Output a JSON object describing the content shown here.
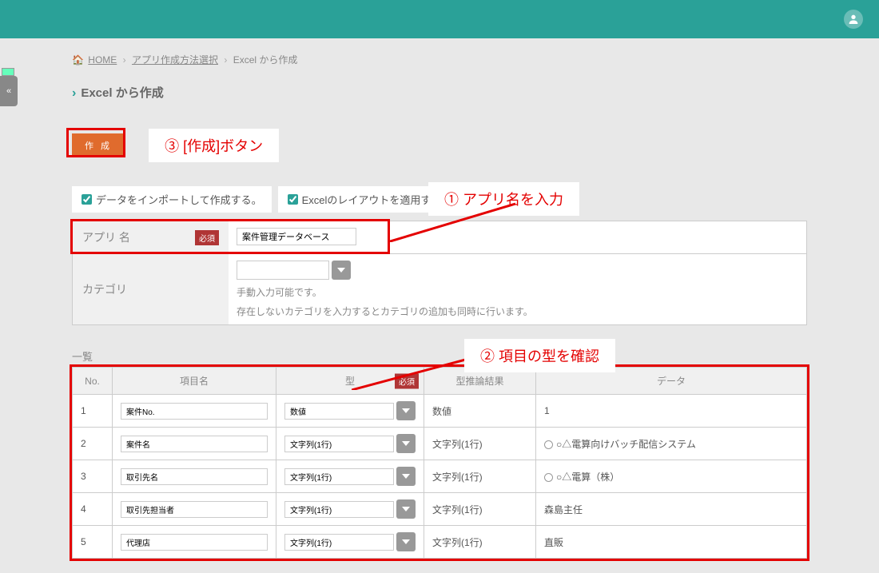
{
  "header": {},
  "breadcrumb": {
    "home": "HOME",
    "step1": "アプリ作成方法選択",
    "current": "Excel から作成"
  },
  "page_title": "Excel から作成",
  "create_button": "作 成",
  "annotations": {
    "a1": "① アプリ名を入力",
    "a2": "② 項目の型を確認",
    "a3": "③ [作成]ボタン"
  },
  "checkboxes": {
    "import": "データをインポートして作成する。",
    "layout": "Excelのレイアウトを適用する。"
  },
  "form": {
    "app_name_label": "アプリ 名",
    "required": "必須",
    "app_name_value": "案件管理データベース",
    "category_label": "カテゴリ",
    "category_help1": "手動入力可能です。",
    "category_help2": "存在しないカテゴリを入力するとカテゴリの追加も同時に行います。"
  },
  "list": {
    "heading": "一覧",
    "headers": {
      "no": "No.",
      "name": "項目名",
      "type": "型",
      "required": "必須",
      "infer": "型推論結果",
      "data": "データ"
    },
    "rows": [
      {
        "no": "1",
        "name": "案件No.",
        "type": "数値",
        "infer": "数値",
        "data": "1",
        "radio": false
      },
      {
        "no": "2",
        "name": "案件名",
        "type": "文字列(1行)",
        "infer": "文字列(1行)",
        "data": "○△電算向けバッチ配信システム",
        "radio": true
      },
      {
        "no": "3",
        "name": "取引先名",
        "type": "文字列(1行)",
        "infer": "文字列(1行)",
        "data": "○△電算（株）",
        "radio": true
      },
      {
        "no": "4",
        "name": "取引先担当者",
        "type": "文字列(1行)",
        "infer": "文字列(1行)",
        "data": "森島主任",
        "radio": false
      },
      {
        "no": "5",
        "name": "代理店",
        "type": "文字列(1行)",
        "infer": "文字列(1行)",
        "data": "直販",
        "radio": false
      }
    ]
  }
}
